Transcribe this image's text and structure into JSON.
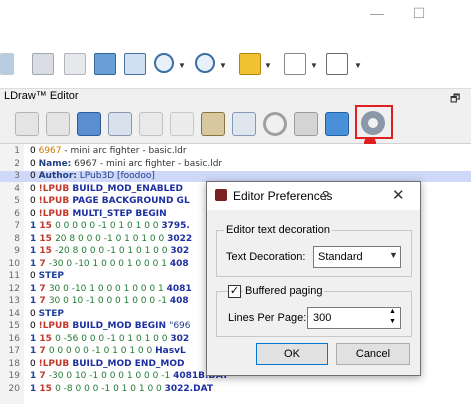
{
  "window": {
    "min_glyph": "—",
    "max_glyph": "☐"
  },
  "dock": {
    "title": "LDraw™ Editor",
    "float_glyph": "🗗"
  },
  "editor": {
    "lines": [
      {
        "num": "1",
        "spans": [
          {
            "t": "0 ",
            "c": "k0"
          },
          {
            "t": "6967",
            "c": "ko"
          },
          {
            "t": " - mini arc fighter - basic.ldr",
            "c": "kx"
          }
        ]
      },
      {
        "num": "2",
        "spans": [
          {
            "t": "0 ",
            "c": "k0"
          },
          {
            "t": "Name:",
            "c": "kbl"
          },
          {
            "t": " 6967 - mini arc fighter - basic.ldr",
            "c": "kx"
          }
        ]
      },
      {
        "num": "3",
        "hl": true,
        "spans": [
          {
            "t": "0 ",
            "c": "k0"
          },
          {
            "t": "Author:",
            "c": "kbl"
          },
          {
            "t": " LPub3D [foodoo]",
            "c": "kd"
          }
        ]
      },
      {
        "num": "4",
        "spans": [
          {
            "t": "0 ",
            "c": "k0"
          },
          {
            "t": "!LPUB",
            "c": "kr"
          },
          {
            "t": " BUILD_MOD_ENABLED",
            "c": "kb"
          }
        ]
      },
      {
        "num": "5",
        "spans": [
          {
            "t": "0 ",
            "c": "k0"
          },
          {
            "t": "!LPUB",
            "c": "kr"
          },
          {
            "t": " PAGE BACKGROUND GL",
            "c": "kb"
          }
        ]
      },
      {
        "num": "6",
        "spans": [
          {
            "t": "0 ",
            "c": "k0"
          },
          {
            "t": "!LPUB",
            "c": "kr"
          },
          {
            "t": " MULTI_STEP BEGIN",
            "c": "kb"
          }
        ]
      },
      {
        "num": "7",
        "spans": [
          {
            "t": "1 ",
            "c": "kn"
          },
          {
            "t": "15 ",
            "c": "kr"
          },
          {
            "t": "0 0 0 0 0 -1 0 1 0 1 0 0 ",
            "c": "kg"
          },
          {
            "t": "3795.",
            "c": "kb"
          }
        ]
      },
      {
        "num": "8",
        "spans": [
          {
            "t": "1 ",
            "c": "kn"
          },
          {
            "t": "15 ",
            "c": "kr"
          },
          {
            "t": "20 8 0 0 0 -1 0 1 0 1 0 0 ",
            "c": "kg"
          },
          {
            "t": "3022",
            "c": "kb"
          }
        ]
      },
      {
        "num": "9",
        "spans": [
          {
            "t": "1 ",
            "c": "kn"
          },
          {
            "t": "15 ",
            "c": "kr"
          },
          {
            "t": "-20 8 0 0 0 -1 0 1 0 1 0 0 ",
            "c": "kg"
          },
          {
            "t": "302",
            "c": "kb"
          }
        ]
      },
      {
        "num": "10",
        "spans": [
          {
            "t": "1 ",
            "c": "kn"
          },
          {
            "t": "7 ",
            "c": "kr"
          },
          {
            "t": "-30 0 -10 1 0 0 0 1 0 0 0 1 ",
            "c": "kg"
          },
          {
            "t": "408",
            "c": "kb"
          }
        ]
      },
      {
        "num": "11",
        "spans": [
          {
            "t": "0 ",
            "c": "k0"
          },
          {
            "t": "STEP",
            "c": "kn"
          }
        ]
      },
      {
        "num": "12",
        "spans": [
          {
            "t": "1 ",
            "c": "kn"
          },
          {
            "t": "7 ",
            "c": "kr"
          },
          {
            "t": "30 0 -10 1 0 0 0 1 0 0 0 1 ",
            "c": "kg"
          },
          {
            "t": "4081",
            "c": "kb"
          }
        ]
      },
      {
        "num": "13",
        "spans": [
          {
            "t": "1 ",
            "c": "kn"
          },
          {
            "t": "7 ",
            "c": "kr"
          },
          {
            "t": "30 0 10 -1 0 0 0 1 0 0 0 -1 ",
            "c": "kg"
          },
          {
            "t": "408",
            "c": "kb"
          }
        ]
      },
      {
        "num": "14",
        "spans": [
          {
            "t": "0 ",
            "c": "k0"
          },
          {
            "t": "STEP",
            "c": "kn"
          }
        ]
      },
      {
        "num": "15",
        "spans": [
          {
            "t": "0 ",
            "c": "k0"
          },
          {
            "t": "!LPUB",
            "c": "kr"
          },
          {
            "t": " BUILD_MOD BEGIN ",
            "c": "kb"
          },
          {
            "t": "\"696",
            "c": "kd"
          }
        ]
      },
      {
        "num": "16",
        "spans": [
          {
            "t": "1 ",
            "c": "kn"
          },
          {
            "t": "15 ",
            "c": "kr"
          },
          {
            "t": "0 -56 0 0 0 -1 0 1 0 1 0 0 ",
            "c": "kg"
          },
          {
            "t": "302",
            "c": "kb"
          }
        ]
      },
      {
        "num": "17",
        "spans": [
          {
            "t": "1 ",
            "c": "kn"
          },
          {
            "t": "7 ",
            "c": "kr"
          },
          {
            "t": "0 0 0 0 0 -1 0 1 0 1 0 0 ",
            "c": "kg"
          },
          {
            "t": "HasvL",
            "c": "kb"
          }
        ]
      },
      {
        "num": "18",
        "spans": [
          {
            "t": "0 ",
            "c": "k0"
          },
          {
            "t": "!LPUB",
            "c": "kr"
          },
          {
            "t": " BUILD_MOD END_MOD",
            "c": "kb"
          }
        ]
      },
      {
        "num": "19",
        "spans": [
          {
            "t": "1 ",
            "c": "kn"
          },
          {
            "t": "7 ",
            "c": "kr"
          },
          {
            "t": "-30 0 10 -1 0 0 0 1 0 0 0 -1 ",
            "c": "kg"
          },
          {
            "t": "4081B.DAT",
            "c": "kb"
          }
        ]
      },
      {
        "num": "20",
        "spans": [
          {
            "t": "1 ",
            "c": "kn"
          },
          {
            "t": "15 ",
            "c": "kr"
          },
          {
            "t": "0 -8 0 0 0 -1 0 1 0 1 0 0 ",
            "c": "kg"
          },
          {
            "t": "3022.DAT",
            "c": "kb"
          }
        ]
      }
    ]
  },
  "dialog": {
    "title": "Editor Preferences",
    "help": "?",
    "close": "✕",
    "group1_title": "Editor text decoration",
    "decoration_label": "Text Decoration:",
    "decoration_value": "Standard",
    "paging_checked": "✓",
    "paging_label": "Buffered paging",
    "lines_label": "Lines Per Page:",
    "lines_value": "300",
    "ok": "OK",
    "cancel": "Cancel"
  }
}
